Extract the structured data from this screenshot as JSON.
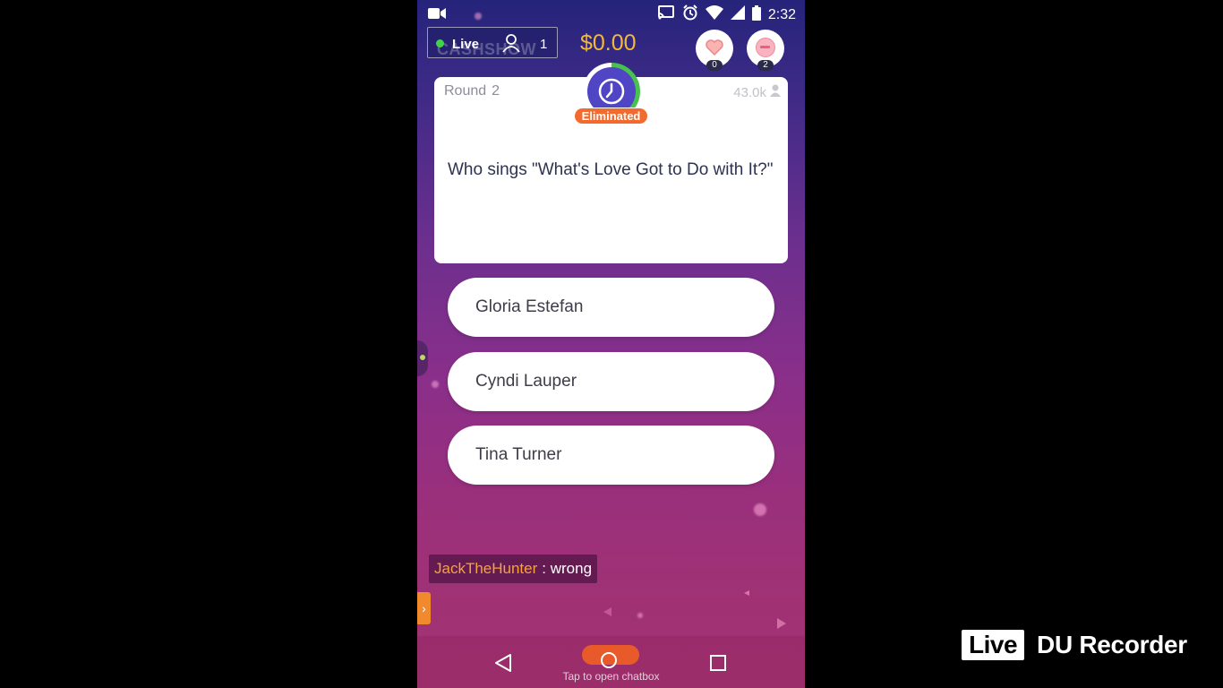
{
  "status_bar": {
    "time": "2:32",
    "icons": [
      "video-camera-icon",
      "cast-icon",
      "alarm-icon",
      "wifi-icon",
      "signal-icon",
      "battery-icon"
    ]
  },
  "header": {
    "watermark": "CASHSHOW",
    "live_label": "Live",
    "viewer_count": "1",
    "prize": "$0.00",
    "heart_count": "0",
    "minus_count": "2"
  },
  "question_card": {
    "round_label": "Round",
    "round_number": "2",
    "player_count": "43.0k",
    "status_badge": "Eliminated",
    "question": "Who sings \"What's Love Got to Do with It?\""
  },
  "answers": [
    {
      "label": "Gloria Estefan"
    },
    {
      "label": "Cyndi Lauper"
    },
    {
      "label": "Tina Turner"
    }
  ],
  "chat": {
    "user": "JackTheHunter",
    "message": ": wrong"
  },
  "nav": {
    "chat_hint": "Tap to open chatbox"
  },
  "recorder": {
    "badge": "Live",
    "name": "DU Recorder"
  },
  "colors": {
    "prize": "#f2b93a",
    "eliminated": "#f26a2e",
    "timer": "#5045c4",
    "chat_user": "#f7a23a"
  }
}
